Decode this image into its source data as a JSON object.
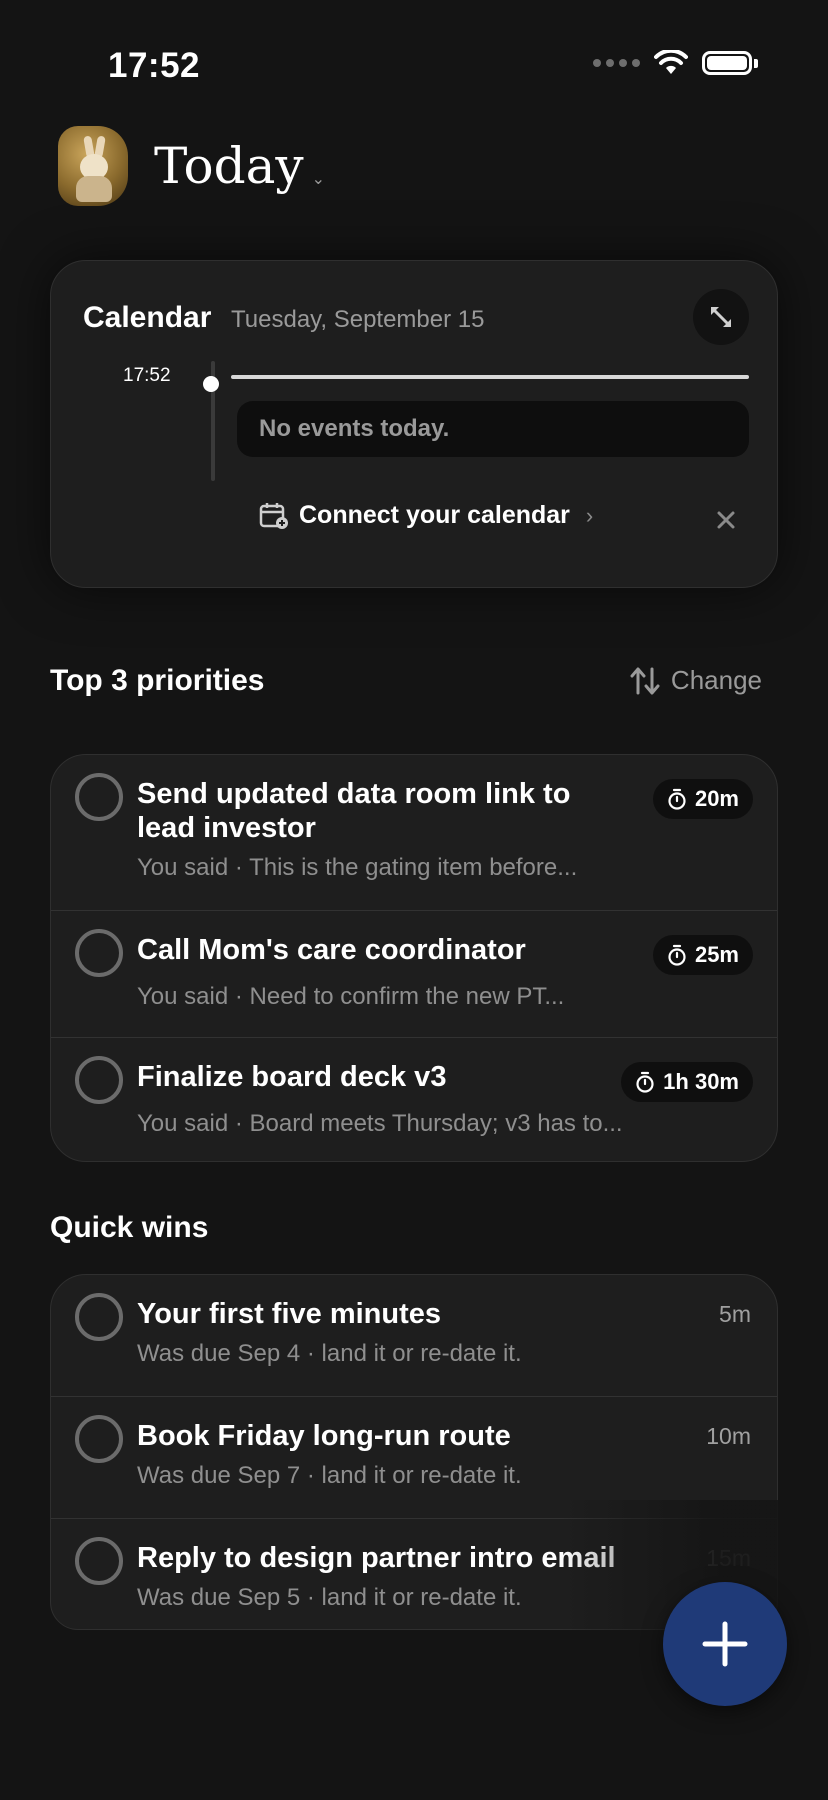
{
  "status_bar": {
    "time": "17:52"
  },
  "header": {
    "title": "Today",
    "chevron": "⌄"
  },
  "calendar": {
    "title": "Calendar",
    "date": "Tuesday, September 15",
    "current_time": "17:52",
    "empty_message": "No events today.",
    "connect_label": "Connect your calendar",
    "connect_chevron": "›"
  },
  "priorities": {
    "title": "Top 3 priorities",
    "change_label": "Change",
    "items": [
      {
        "title": "Send updated data room link to lead investor",
        "subtitle": "You said · This is the gating item before...",
        "duration": "20m"
      },
      {
        "title": "Call Mom's care coordinator",
        "subtitle": "You said · Need to confirm the new PT...",
        "duration": "25m"
      },
      {
        "title": "Finalize board deck v3",
        "subtitle": "You said · Board meets Thursday; v3 has to...",
        "duration": "1h 30m"
      }
    ]
  },
  "quick_wins": {
    "title": "Quick wins",
    "items": [
      {
        "title": "Your first five minutes",
        "subtitle": "Was due Sep 4 · land it or re-date it.",
        "duration": "5m"
      },
      {
        "title": "Book Friday long-run route",
        "subtitle": "Was due Sep 7 · land it or re-date it.",
        "duration": "10m"
      },
      {
        "title": "Reply to design partner intro email",
        "subtitle": "Was due Sep 5 · land it or re-date it.",
        "duration": "15m"
      }
    ]
  },
  "colors": {
    "background": "#141414",
    "card": "#1e1e1e",
    "fab": "#1f3a78",
    "muted_text": "#8f8f8f"
  },
  "icons": {
    "expand": "expand-icon",
    "calendar_add": "calendar-add-icon",
    "close": "close-icon",
    "sort": "sort-arrows-icon",
    "timer": "timer-icon",
    "plus": "plus-icon"
  }
}
